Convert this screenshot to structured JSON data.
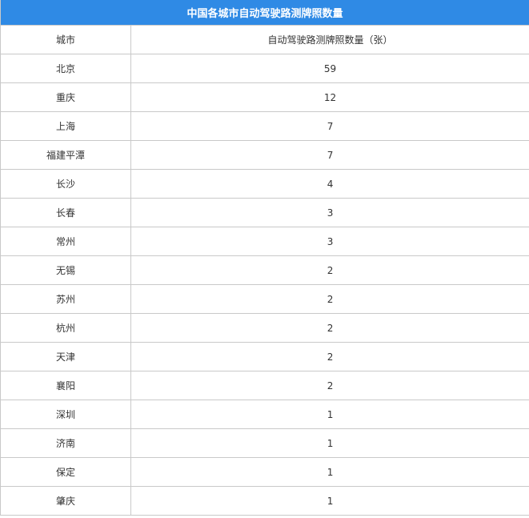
{
  "table": {
    "title": "中国各城市自动驾驶路测牌照数量",
    "headers": [
      "城市",
      "自动驾驶路测牌照数量（张）"
    ],
    "rows": [
      {
        "city": "北京",
        "count": "59"
      },
      {
        "city": "重庆",
        "count": "12"
      },
      {
        "city": "上海",
        "count": "7"
      },
      {
        "city": "福建平潭",
        "count": "7"
      },
      {
        "city": "长沙",
        "count": "4"
      },
      {
        "city": "长春",
        "count": "3"
      },
      {
        "city": "常州",
        "count": "3"
      },
      {
        "city": "无锡",
        "count": "2"
      },
      {
        "city": "苏州",
        "count": "2"
      },
      {
        "city": "杭州",
        "count": "2"
      },
      {
        "city": "天津",
        "count": "2"
      },
      {
        "city": "襄阳",
        "count": "2"
      },
      {
        "city": "深圳",
        "count": "1"
      },
      {
        "city": "济南",
        "count": "1"
      },
      {
        "city": "保定",
        "count": "1"
      },
      {
        "city": "肇庆",
        "count": "1"
      }
    ]
  },
  "colors": {
    "header_bg": "#2f8ae5",
    "header_text": "#ffffff",
    "border": "#c9c9c9",
    "text": "#333333"
  }
}
